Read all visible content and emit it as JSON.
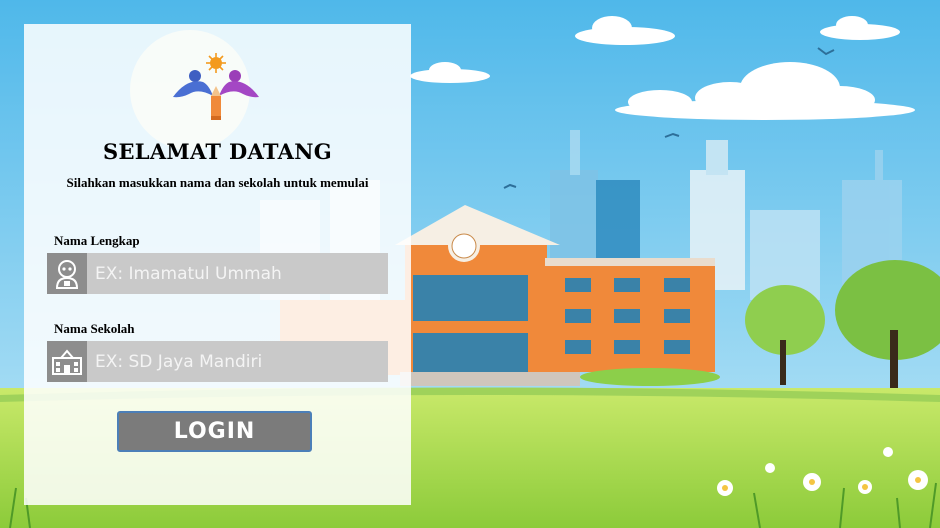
{
  "welcome": {
    "title": "SELAMAT DATANG",
    "subtitle": "Silahkan masukkan nama dan sekolah untuk memulai"
  },
  "form": {
    "name_label": "Nama Lengkap",
    "name_placeholder": "EX: Imamatul Ummah",
    "name_icon": "student-icon",
    "school_label": "Nama Sekolah",
    "school_placeholder": "EX: SD Jaya Mandiri",
    "school_icon": "school-icon",
    "login_label": "LOGIN"
  },
  "colors": {
    "sky": "#6cc6ee",
    "grass": "#a9d84a",
    "building": "#f08a3a",
    "input_bg": "#c9c9c9",
    "icon_bg": "#8d8d8d",
    "button_bg": "#7b7b7b",
    "button_border": "#4c7fb8"
  }
}
